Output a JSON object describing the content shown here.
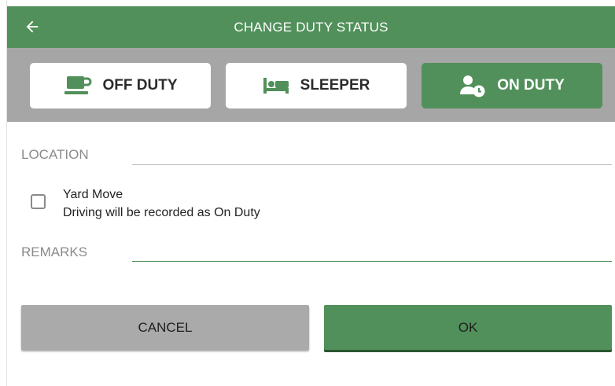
{
  "header": {
    "title": "CHANGE DUTY STATUS",
    "back_icon": "arrow-left-icon"
  },
  "status_buttons": [
    {
      "label": "OFF DUTY",
      "icon": "coffee-cup-icon",
      "active": false
    },
    {
      "label": "SLEEPER",
      "icon": "bed-icon",
      "active": false
    },
    {
      "label": "ON DUTY",
      "icon": "person-clock-icon",
      "active": true
    }
  ],
  "form": {
    "location_label": "LOCATION",
    "location_value": "",
    "yard_move_title": "Yard Move",
    "yard_move_subtitle": "Driving will be recorded as On Duty",
    "yard_move_checked": false,
    "remarks_label": "REMARKS",
    "remarks_value": ""
  },
  "actions": {
    "cancel_label": "CANCEL",
    "ok_label": "OK"
  },
  "colors": {
    "accent": "#51905a",
    "strip": "#a6a6a6",
    "cancel": "#aaaaaa"
  }
}
